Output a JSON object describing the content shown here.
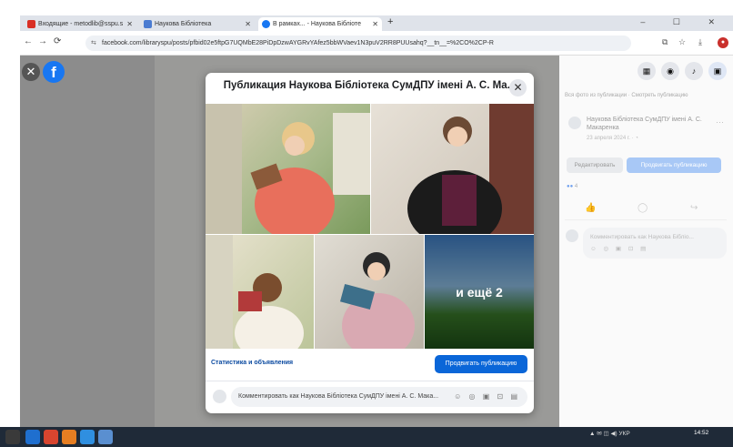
{
  "browser": {
    "tabs": [
      {
        "label": "Входящие - metodlib@sspu.s",
        "icon_color": "#d93025"
      },
      {
        "label": "Наукова Бібліотека",
        "icon_color": "#4a7bd1"
      },
      {
        "label": "В рамках... - Наукова Бібліоте",
        "icon_color": "#1877f2"
      }
    ],
    "new_tab": "+",
    "url_site": "⇆",
    "url": "facebook.com/libraryspu/posts/pfbid02e5ftpG7UQMbE28PiDpDzwAYGRvYAfez5bbWVaev1N3puV2RR8PUUsahq?__tn__=%2CO%2CP-R",
    "nav": {
      "back": "←",
      "forward": "→",
      "reload": "⟳"
    }
  },
  "facebook": {
    "logo": "f",
    "close": "✕",
    "right_panel": {
      "links": "Вся фото из публикации · Смотреть публикацию",
      "author": "Наукова Бібліотека СумДПУ імені А. С. Макаренка",
      "date": "23 апреля 2024 г. · ◔",
      "more": "···",
      "edit_label": "Редактировать",
      "promote_label": "Продвигать публикацию",
      "reactions": "4",
      "comment_placeholder": "Комментировать как Наукова Бібліо..."
    },
    "dialog": {
      "title": "Публикация Наукова Бібліотека СумДПУ імені А. С. Ма...",
      "close": "✕",
      "more_photos": "и ещё 2",
      "stats_link": "Статистика и объявления",
      "promote_button": "Продвигать публикацию",
      "comment_placeholder": "Комментировать как Наукова Бібліотека СумДПУ імені А. С. Мака...",
      "comment_icons": "☺ ◎ ▣ ⊡ ▤"
    }
  },
  "taskbar": {
    "tray": "▲ ✉ ◫ ◀) УКР",
    "time": "14:52"
  },
  "colors": {
    "brand": "#1877f2",
    "promote": "#0a66d8"
  }
}
